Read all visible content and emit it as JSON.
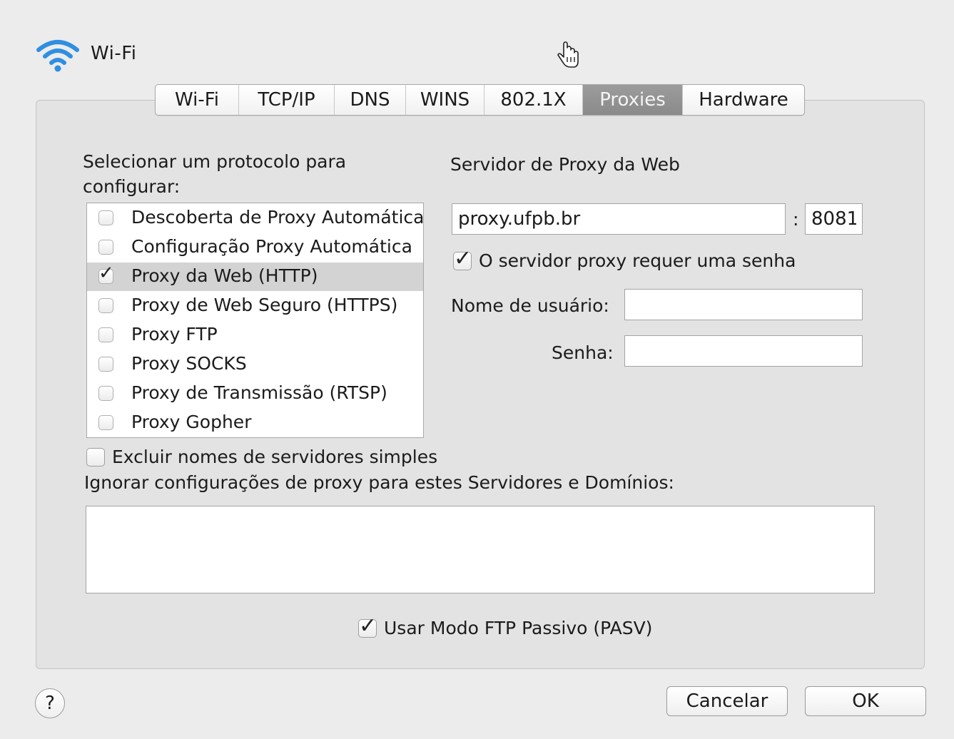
{
  "window": {
    "title": "Wi-Fi",
    "icon": "wifi-icon",
    "cursor": "hand-cursor-icon"
  },
  "tabs": [
    {
      "label": "Wi-Fi",
      "active": false
    },
    {
      "label": "TCP/IP",
      "active": false
    },
    {
      "label": "DNS",
      "active": false
    },
    {
      "label": "WINS",
      "active": false
    },
    {
      "label": "802.1X",
      "active": false
    },
    {
      "label": "Proxies",
      "active": true
    },
    {
      "label": "Hardware",
      "active": false
    }
  ],
  "protocols": {
    "heading_line1": "Selecionar um protocolo para",
    "heading_line2": "configurar:",
    "items": [
      {
        "label": "Descoberta de Proxy Automática",
        "checked": false,
        "selected": false
      },
      {
        "label": "Configuração Proxy Automática",
        "checked": false,
        "selected": false
      },
      {
        "label": "Proxy da Web (HTTP)",
        "checked": true,
        "selected": true
      },
      {
        "label": "Proxy de Web Seguro (HTTPS)",
        "checked": false,
        "selected": false
      },
      {
        "label": "Proxy FTP",
        "checked": false,
        "selected": false
      },
      {
        "label": "Proxy SOCKS",
        "checked": false,
        "selected": false
      },
      {
        "label": "Proxy de Transmissão (RTSP)",
        "checked": false,
        "selected": false
      },
      {
        "label": "Proxy Gopher",
        "checked": false,
        "selected": false
      }
    ]
  },
  "server": {
    "heading": "Servidor de Proxy da Web",
    "host": "proxy.ufpb.br",
    "separator": ":",
    "port": "8081",
    "requires_password_label": "O servidor proxy requer uma senha",
    "requires_password": true,
    "username_label": "Nome de usuário:",
    "username": "",
    "password_label": "Senha:",
    "password": ""
  },
  "bypass": {
    "exclude_simple_label": "Excluir nomes de servidores simples",
    "exclude_simple": false,
    "ignore_label": "Ignorar configurações de proxy para estes Servidores e Domínios:",
    "ignore_value": ""
  },
  "passive_ftp": {
    "label": "Usar Modo FTP Passivo (PASV)",
    "checked": true
  },
  "footer": {
    "help_label": "?",
    "cancel_label": "Cancelar",
    "ok_label": "OK"
  },
  "colors": {
    "wifi_blue": "#2f8fe0",
    "active_tab": "#8f8f8f",
    "selection": "#d3d3d3"
  }
}
